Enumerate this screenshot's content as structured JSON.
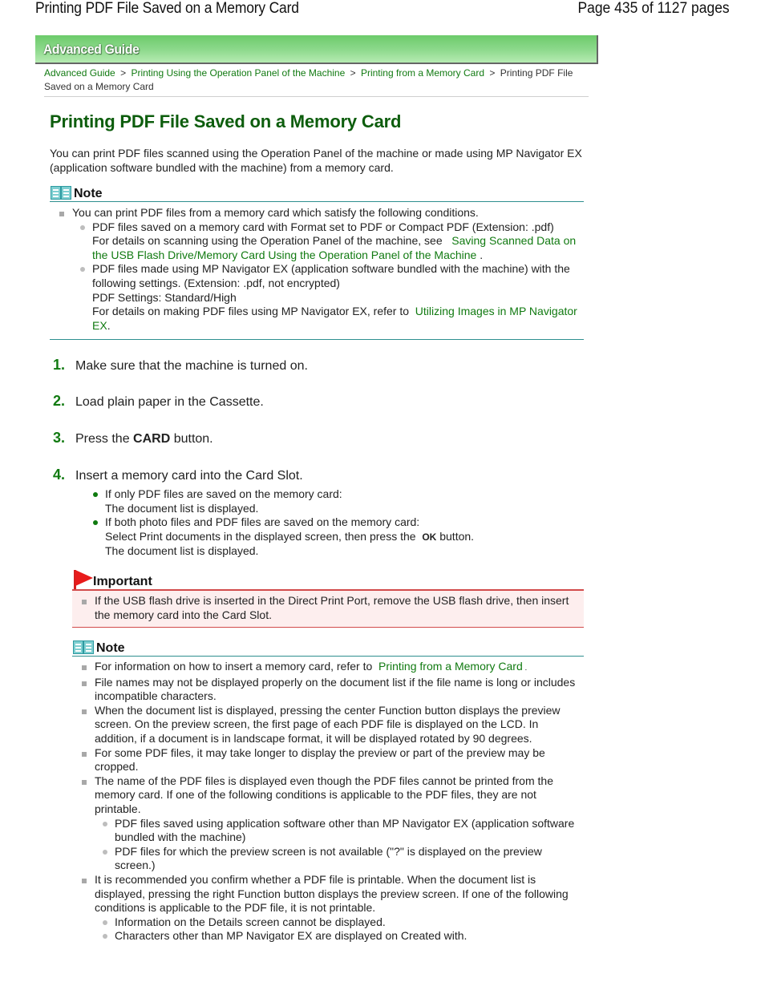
{
  "header": {
    "doc_title": "Printing PDF File Saved on a Memory Card",
    "page_indicator": "Page 435 of 1127 pages"
  },
  "banner": {
    "label": "Advanced Guide"
  },
  "breadcrumb": {
    "items": [
      {
        "label": "Advanced Guide",
        "link": true
      },
      {
        "label": "Printing Using the Operation Panel of the Machine",
        "link": true
      },
      {
        "label": "Printing from a Memory Card",
        "link": true
      },
      {
        "label": "Printing PDF File Saved on a Memory Card",
        "link": false
      }
    ],
    "separator": ">"
  },
  "main": {
    "title": "Printing PDF File Saved on a Memory Card",
    "intro": "You can print PDF files scanned using the Operation Panel of the machine or made using MP Navigator EX (application software bundled with the machine) from a memory card."
  },
  "note1": {
    "label": "Note",
    "item": "You can print PDF files from a memory card which satisfy the following conditions.",
    "sub": [
      {
        "line1": "PDF files saved on a memory card with Format set to PDF or Compact PDF (Extension: .pdf)",
        "line2": "For details on scanning using the Operation Panel of the machine, see",
        "link": "Saving Scanned Data on the USB Flash Drive/Memory Card Using the Operation Panel of the Machine",
        "end": " ."
      },
      {
        "line1": "PDF files made using MP Navigator EX (application software bundled with the machine) with the following settings. (Extension: .pdf, not encrypted)",
        "line2": "PDF Settings: Standard/High",
        "line3": "For details on making PDF files using MP Navigator EX, refer to",
        "link": "Utilizing Images in MP Navigator EX",
        "end": "."
      }
    ]
  },
  "steps": [
    {
      "num": "1.",
      "text": "Make sure that the machine is turned on."
    },
    {
      "num": "2.",
      "text": "Load plain paper in the Cassette."
    },
    {
      "num": "3.",
      "pre": "Press the ",
      "bold": "CARD",
      "post": " button."
    },
    {
      "num": "4.",
      "text": "Insert a memory card into the Card Slot."
    }
  ],
  "step4_items": [
    {
      "line1": "If only PDF files are saved on the memory card:",
      "line2": "The document list is displayed."
    },
    {
      "line1": "If both photo files and PDF files are saved on the memory card:",
      "line2_pre": "Select Print documents in the displayed screen, then press the ",
      "line2_bold": "OK",
      "line2_post": " button.",
      "line3": "The document list is displayed."
    }
  ],
  "important": {
    "label": "Important",
    "item": "If the USB flash drive is inserted in the Direct Print Port, remove the USB flash drive, then insert the memory card into the Card Slot."
  },
  "note2": {
    "label": "Note",
    "items": [
      {
        "pre": "For information on how to insert a memory card, refer to ",
        "link": "Printing from a Memory Card",
        "end": " ."
      },
      {
        "text": "File names may not be displayed properly on the document list if the file name is long or includes incompatible characters."
      },
      {
        "text": "When the document list is displayed, pressing the center Function button displays the preview screen. On the preview screen, the first page of each PDF file is displayed on the LCD. In addition, if a document is in landscape format, it will be displayed rotated by 90 degrees."
      },
      {
        "text": "For some PDF files, it may take longer to display the preview or part of the preview may be cropped."
      },
      {
        "text": "The name of the PDF files is displayed even though the PDF files cannot be printed from the memory card. If one of the following conditions is applicable to the PDF files, they are not printable.",
        "sub": [
          "PDF files saved using application software other than MP Navigator EX (application software bundled with the machine)",
          "PDF files for which the preview screen is not available (\"?\" is displayed on the preview screen.)"
        ]
      },
      {
        "text": "It is recommended you confirm whether a PDF file is printable. When the document list is displayed, pressing the right Function button displays the preview screen. If one of the following conditions is applicable to the PDF file, it is not printable.",
        "sub": [
          "Information on the Details screen cannot be displayed.",
          "Characters other than MP Navigator EX are displayed on Created with."
        ]
      }
    ]
  },
  "colors": {
    "link": "#117a11",
    "heading": "#0d5d0d",
    "note_rule": "#2e8f8f",
    "important_rule": "#d24b4b",
    "important_bg": "#fdeeee"
  }
}
